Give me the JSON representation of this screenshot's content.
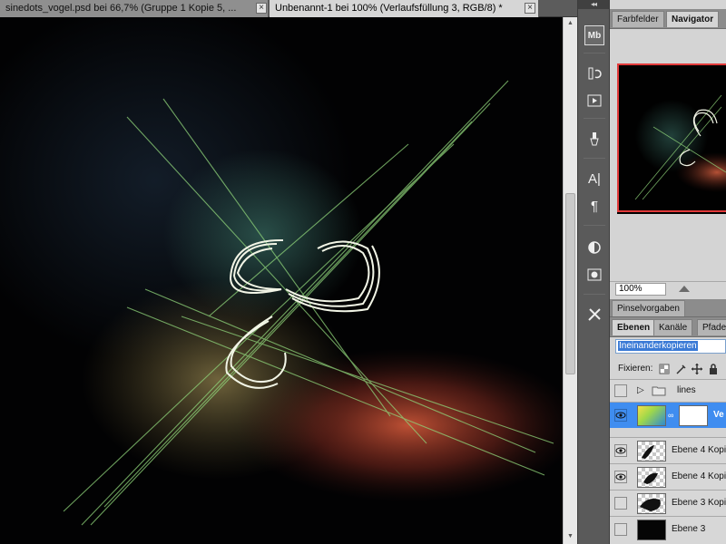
{
  "documents": {
    "tabs": [
      {
        "label": "sinedots_vogel.psd bei 66,7% (Gruppe 1 Kopie 5, ...",
        "active": false
      },
      {
        "label": "Unbenannt-1 bei 100% (Verlaufsfüllung 3, RGB/8) *",
        "active": true
      }
    ],
    "close_glyph": "×"
  },
  "icon_strip": {
    "collapse_glyph": "◂◂",
    "buttons": [
      "mini-bridge-icon",
      "history-icon",
      "actions-icon",
      "brushes-icon",
      "character-icon",
      "paragraph-icon",
      "adjustments-icon",
      "masks-icon",
      "tool-presets-icon"
    ],
    "mb_label": "Mb",
    "type_label": "A|",
    "paragraph_label": "¶"
  },
  "panel": {
    "top_tabs": [
      {
        "label": "Farbfelder",
        "active": false
      },
      {
        "label": "Navigator",
        "active": true
      }
    ],
    "navigator": {
      "zoom": "100%"
    },
    "presets_tab": {
      "label": "Pinselvorgaben"
    },
    "layer_tabs": [
      {
        "label": "Ebenen",
        "active": true
      },
      {
        "label": "Kanäle",
        "active": false
      },
      {
        "label": "Pfade",
        "active": false
      }
    ],
    "blend_mode": "Ineinanderkopieren",
    "lock_label": "Fixieren:",
    "layers": [
      {
        "name": "lines",
        "type": "group",
        "visible": false,
        "selected": false
      },
      {
        "name": "Ve",
        "type": "gradient-fill",
        "visible": true,
        "selected": true
      },
      {
        "name": "Ebene 4 Kopi",
        "type": "layer",
        "visible": true,
        "selected": false
      },
      {
        "name": "Ebene 4 Kopi",
        "type": "layer",
        "visible": true,
        "selected": false
      },
      {
        "name": "Ebene 3 Kopi",
        "type": "layer",
        "visible": false,
        "selected": false
      },
      {
        "name": "Ebene 3",
        "type": "layer",
        "visible": false,
        "selected": false
      }
    ]
  },
  "colors": {
    "selection_blue": "#3f8df0",
    "navigator_frame": "#e23a3a",
    "canvas_bg": "#020203"
  }
}
